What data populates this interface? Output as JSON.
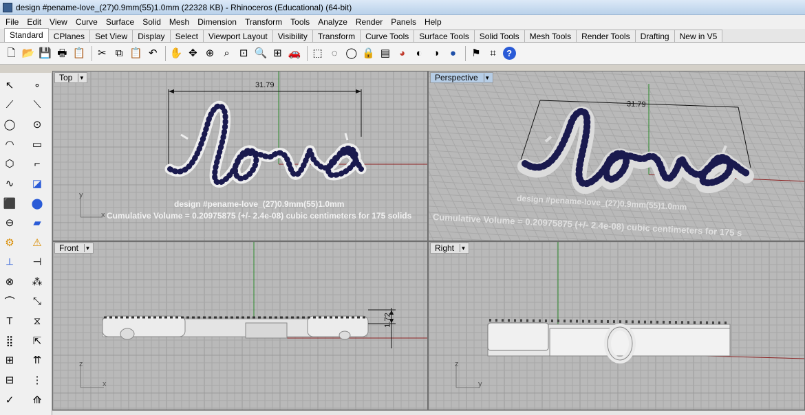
{
  "window": {
    "title": "design #pename-love_(27)0.9mm(55)1.0mm (22328 KB) - Rhinoceros (Educational) (64-bit)"
  },
  "menu": [
    "File",
    "Edit",
    "View",
    "Curve",
    "Surface",
    "Solid",
    "Mesh",
    "Dimension",
    "Transform",
    "Tools",
    "Analyze",
    "Render",
    "Panels",
    "Help"
  ],
  "tabs": [
    "Standard",
    "CPlanes",
    "Set View",
    "Display",
    "Select",
    "Viewport Layout",
    "Visibility",
    "Transform",
    "Curve Tools",
    "Surface Tools",
    "Solid Tools",
    "Mesh Tools",
    "Render Tools",
    "Drafting",
    "New in V5"
  ],
  "active_tab": "Standard",
  "toolbar_icons": [
    "new-file-icon",
    "open-file-icon",
    "save-icon",
    "print-icon",
    "import-icon",
    "cut-icon",
    "copy-icon",
    "paste-icon",
    "undo-icon",
    "pan-hand-icon",
    "rotate-view-icon",
    "zoom-dynamic-icon",
    "zoom-window-icon",
    "zoom-extents-icon",
    "zoom-selected-icon",
    "four-viewports-icon",
    "car-icon",
    "select-all-icon",
    "hide-icon",
    "show-icon",
    "lock-icon",
    "layers-icon",
    "color-wheel-icon",
    "shaded-sphere-icon",
    "rendered-sphere-icon",
    "render-sphere-icon",
    "dimension-icon",
    "grid-options-icon",
    "help-icon"
  ],
  "viewports": {
    "top": {
      "label": "Top",
      "dimension": "31.79",
      "annotation_line1": "design #pename-love_(27)0.9mm(55)1.0mm",
      "annotation_line2": "Cumulative Volume = 0.20975875 (+/- 2.4e-08) cubic centimeters for 175 solids",
      "axis_x": "x",
      "axis_y": "y"
    },
    "perspective": {
      "label": "Perspective",
      "dimension": "31.79",
      "annotation_line1": "design #pename-love_(27)0.9mm(55)1.0mm",
      "annotation_line2": "Cumulative Volume = 0.20975875 (+/- 2.4e-08) cubic centimeters for 175 s"
    },
    "front": {
      "label": "Front",
      "dimension": "1.72",
      "axis_x": "x",
      "axis_z": "z"
    },
    "right": {
      "label": "Right",
      "axis_y": "y",
      "axis_z": "z"
    }
  },
  "colors": {
    "viewport_bg": "#b9b9b9",
    "grid_line": "#a8a8a8",
    "grid_major": "#9a9a9a",
    "axis_red": "#8b2020",
    "axis_green": "#2a8a2a",
    "gem": "#1a1a4e",
    "metal": "#ececec"
  }
}
